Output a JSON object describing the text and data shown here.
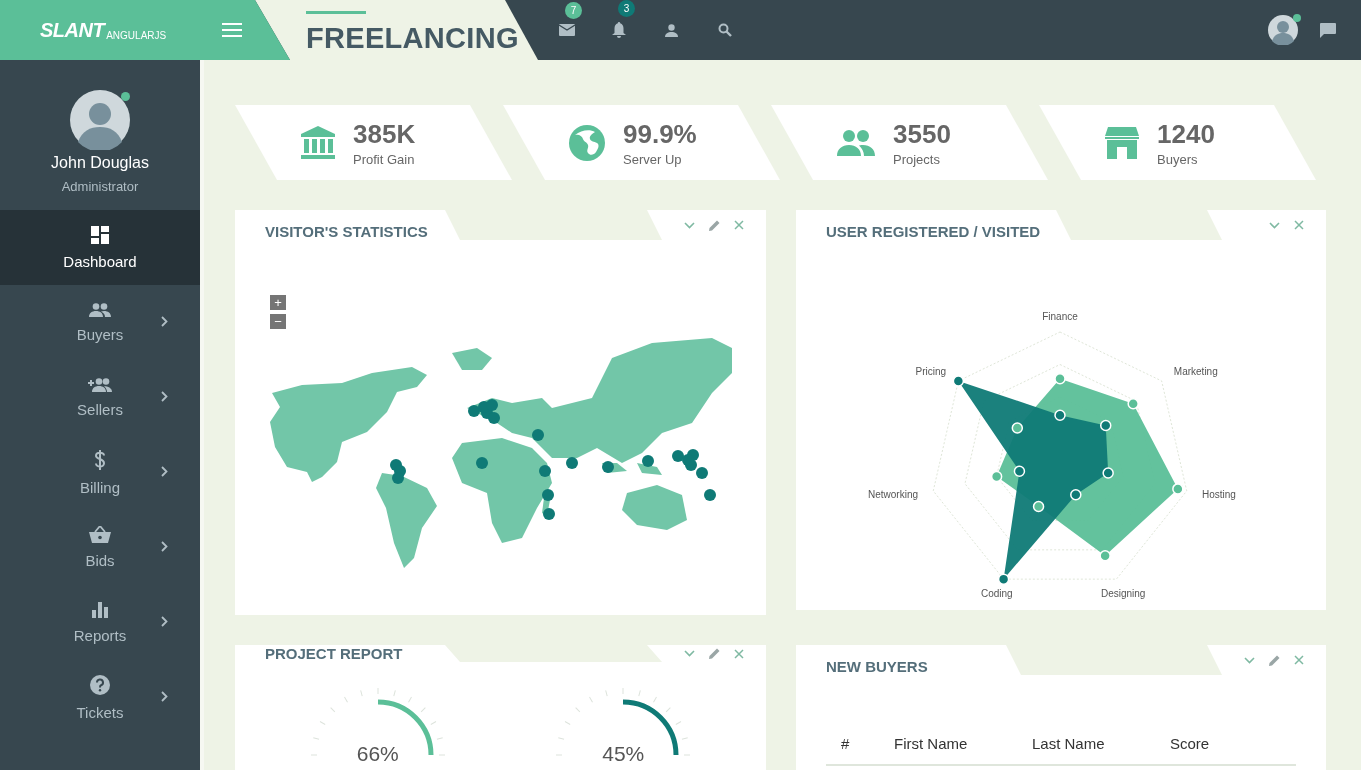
{
  "topbar": {
    "logo": "SLANT",
    "logo_sub": "ANGULARJS",
    "title": "FREELANCING",
    "mail_badge": "7",
    "bell_badge": "3",
    "online": true
  },
  "profile": {
    "name": "John Douglas",
    "role": "Administrator",
    "online": true
  },
  "sidebar": {
    "items": [
      {
        "label": "Dashboard",
        "selected": true,
        "submenu": false
      },
      {
        "label": "Buyers",
        "selected": false,
        "submenu": true
      },
      {
        "label": "Sellers",
        "selected": false,
        "submenu": true
      },
      {
        "label": "Billing",
        "selected": false,
        "submenu": true
      },
      {
        "label": "Bids",
        "selected": false,
        "submenu": true
      },
      {
        "label": "Reports",
        "selected": false,
        "submenu": true
      },
      {
        "label": "Tickets",
        "selected": false,
        "submenu": true
      }
    ]
  },
  "stats": [
    {
      "value": "385K",
      "label": "Profit Gain"
    },
    {
      "value": "99.9%",
      "label": "Server Up"
    },
    {
      "value": "3550",
      "label": "Projects"
    },
    {
      "value": "1240",
      "label": "Buyers"
    }
  ],
  "visitors": {
    "title": "VISITOR'S STATISTICS",
    "zoom_in": "+",
    "zoom_out": "−"
  },
  "radar": {
    "title": "USER REGISTERED / VISITED",
    "axes": [
      "Finance",
      "Marketing",
      "Hosting",
      "Designing",
      "Coding",
      "Networking",
      "Pricing"
    ]
  },
  "project_report": {
    "title": "PROJECT REPORT",
    "gauges": [
      {
        "reading": "66%",
        "color": "#5bbf98"
      },
      {
        "reading": "45%",
        "color": "#0f7a76"
      }
    ]
  },
  "new_buyers": {
    "title": "NEW BUYERS",
    "columns": [
      "#",
      "First Name",
      "Last Name",
      "Score"
    ]
  }
}
